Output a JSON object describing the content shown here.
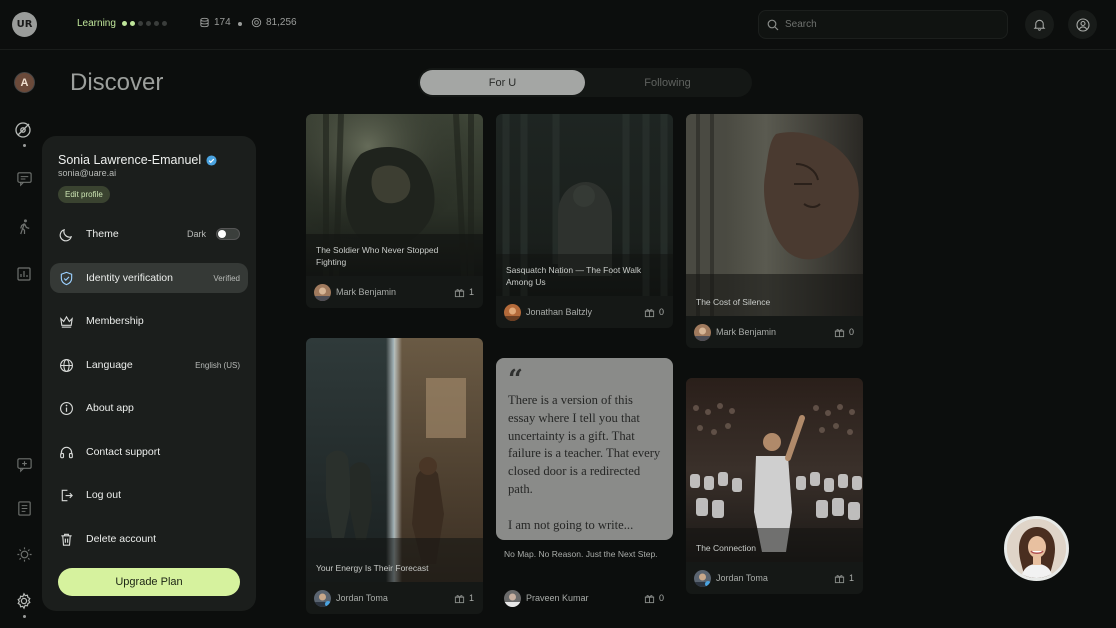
{
  "topbar": {
    "logo": "UR",
    "learning_label": "Learning",
    "progress_level": 2,
    "progress_total": 6,
    "stat_one": "174",
    "stat_two": "81,256",
    "search_placeholder": "Search"
  },
  "page": {
    "title": "Discover",
    "tabs": [
      {
        "label": "For U",
        "active": true
      },
      {
        "label": "Following",
        "active": false
      }
    ]
  },
  "profile": {
    "name": "Sonia Lawrence-Emanuel",
    "email": "sonia@uare.ai",
    "edit_label": "Edit profile",
    "rail_avatar_initial": "A"
  },
  "menu": [
    {
      "label": "Theme",
      "value": "Dark",
      "icon": "moon-icon"
    },
    {
      "label": "Identity verification",
      "value": "Verified",
      "icon": "shield-icon"
    },
    {
      "label": "Membership",
      "value": "",
      "icon": "crown-icon"
    },
    {
      "label": "Language",
      "value": "English (US)",
      "icon": "globe-icon"
    },
    {
      "label": "About app",
      "value": "",
      "icon": "info-icon"
    },
    {
      "label": "Contact support",
      "value": "",
      "icon": "headset-icon"
    },
    {
      "label": "Log out",
      "value": "",
      "icon": "logout-icon"
    },
    {
      "label": "Delete account",
      "value": "",
      "icon": "trash-icon"
    }
  ],
  "upgrade_label": "Upgrade Plan",
  "cards": [
    {
      "title": "The Soldier Who Never Stopped Fighting",
      "author": "Mark Benjamin",
      "count": "1"
    },
    {
      "title": "Sasquatch Nation — The Foot Walk Among Us",
      "author": "Jonathan Baltzly",
      "count": "0"
    },
    {
      "title": "The Cost of Silence",
      "author": "Mark Benjamin",
      "count": "0"
    },
    {
      "title": "Your Energy Is Their Forecast",
      "author": "Jordan Toma",
      "count": "1"
    },
    {
      "title": "No Map. No Reason. Just the Next Step.",
      "author": "Praveen Kumar",
      "count": "0"
    },
    {
      "title": "The Connection",
      "author": "Jordan Toma",
      "count": "1"
    }
  ],
  "quote": {
    "mark": "“",
    "text": "There is a version of this essay where I tell you that uncertainty is a gift. That failure is a teacher. That every closed door is a redirected path.",
    "text2": "I am not going to write..."
  },
  "colors": {
    "accent": "#d6f29e",
    "background": "#0c0e0d",
    "panel": "#1b1e1c"
  }
}
